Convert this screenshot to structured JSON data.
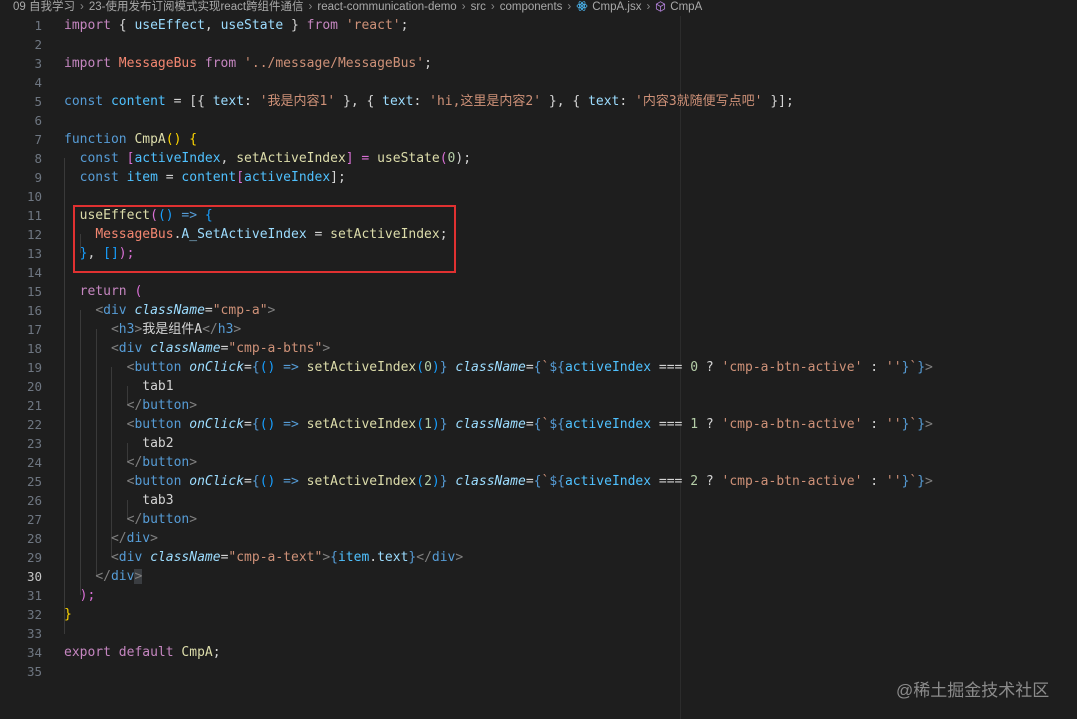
{
  "breadcrumb": {
    "items": [
      "09 自我学习",
      "23-使用发布订阅模式实现react跨组件通信",
      "react-communication-demo",
      "src",
      "components",
      "CmpA.jsx",
      "CmpA"
    ]
  },
  "editor": {
    "active_line": 30,
    "lines": [
      {
        "n": "1"
      },
      {
        "n": "2"
      },
      {
        "n": "3"
      },
      {
        "n": "4"
      },
      {
        "n": "5"
      },
      {
        "n": "6"
      },
      {
        "n": "7"
      },
      {
        "n": "8"
      },
      {
        "n": "9"
      },
      {
        "n": "10"
      },
      {
        "n": "11"
      },
      {
        "n": "12"
      },
      {
        "n": "13"
      },
      {
        "n": "14"
      },
      {
        "n": "15"
      },
      {
        "n": "16"
      },
      {
        "n": "17"
      },
      {
        "n": "18"
      },
      {
        "n": "19"
      },
      {
        "n": "20"
      },
      {
        "n": "21"
      },
      {
        "n": "22"
      },
      {
        "n": "23"
      },
      {
        "n": "24"
      },
      {
        "n": "25"
      },
      {
        "n": "26"
      },
      {
        "n": "27"
      },
      {
        "n": "28"
      },
      {
        "n": "29"
      },
      {
        "n": "30"
      },
      {
        "n": "31"
      },
      {
        "n": "32"
      },
      {
        "n": "33"
      },
      {
        "n": "34"
      },
      {
        "n": "35"
      }
    ]
  },
  "code": {
    "l1": [
      "import",
      " { ",
      "useEffect",
      ", ",
      "useState",
      " } ",
      "from",
      " ",
      "'react'",
      ";"
    ],
    "l3": [
      "import",
      " ",
      "MessageBus",
      " ",
      "from",
      " ",
      "'../message/MessageBus'",
      ";"
    ],
    "l5": [
      "const",
      " ",
      "content",
      " = [{ ",
      "text",
      ": ",
      "'我是内容1'",
      " }, { ",
      "text",
      ": ",
      "'hi,这里是内容2'",
      " }, { ",
      "text",
      ": ",
      "'内容3就随便写点吧'",
      " }];"
    ],
    "l7": [
      "function",
      " ",
      "CmpA",
      "() {"
    ],
    "l8": [
      "const",
      " [",
      "activeIndex",
      ", ",
      "setActiveIndex",
      "] = ",
      "useState",
      "(",
      "0",
      ");"
    ],
    "l9": [
      "const",
      " ",
      "item",
      " = ",
      "content",
      "[",
      "activeIndex",
      "];"
    ],
    "l11": [
      "useEffect",
      "(",
      "()",
      " => ",
      "{"
    ],
    "l12": [
      "MessageBus",
      ".",
      "A_SetActiveIndex",
      " = ",
      "setActiveIndex",
      ";"
    ],
    "l13": [
      "}",
      ", ",
      "[]",
      ");"
    ],
    "l15": [
      "return",
      " ("
    ],
    "l16": [
      "<",
      "div",
      " ",
      "className",
      "=",
      "\"cmp-a\"",
      ">"
    ],
    "l17": [
      "<",
      "h3",
      ">",
      "我是组件A",
      "</",
      "h3",
      ">"
    ],
    "l18": [
      "<",
      "div",
      " ",
      "className",
      "=",
      "\"cmp-a-btns\"",
      ">"
    ],
    "l19": [
      "<",
      "button",
      " ",
      "onClick",
      "=",
      "{",
      "()",
      " => ",
      "setActiveIndex",
      "(",
      "0",
      ")",
      "}",
      " ",
      "className",
      "=",
      "{",
      "`",
      "${",
      "activeIndex",
      " === ",
      "0",
      " ? ",
      "'cmp-a-btn-active'",
      " : ",
      "''",
      "}",
      "`",
      "}",
      ">"
    ],
    "l20": [
      "tab1"
    ],
    "l21": [
      "</",
      "button",
      ">"
    ],
    "l22": [
      "<",
      "button",
      " ",
      "onClick",
      "=",
      "{",
      "()",
      " => ",
      "setActiveIndex",
      "(",
      "1",
      ")",
      "}",
      " ",
      "className",
      "=",
      "{",
      "`",
      "${",
      "activeIndex",
      " === ",
      "1",
      " ? ",
      "'cmp-a-btn-active'",
      " : ",
      "''",
      "}",
      "`",
      "}",
      ">"
    ],
    "l23": [
      "tab2"
    ],
    "l24": [
      "</",
      "button",
      ">"
    ],
    "l25": [
      "<",
      "button",
      " ",
      "onClick",
      "=",
      "{",
      "()",
      " => ",
      "setActiveIndex",
      "(",
      "2",
      ")",
      "}",
      " ",
      "className",
      "=",
      "{",
      "`",
      "${",
      "activeIndex",
      " === ",
      "2",
      " ? ",
      "'cmp-a-btn-active'",
      " : ",
      "''",
      "}",
      "`",
      "}",
      ">"
    ],
    "l26": [
      "tab3"
    ],
    "l27": [
      "</",
      "button",
      ">"
    ],
    "l28": [
      "</",
      "div",
      ">"
    ],
    "l29": [
      "<",
      "div",
      " ",
      "className",
      "=",
      "\"cmp-a-text\"",
      ">",
      "{",
      "item",
      ".",
      "text",
      "}",
      "</",
      "div",
      ">"
    ],
    "l30": [
      "</",
      "div",
      ">"
    ],
    "l31": [
      ");"
    ],
    "l32": [
      "}"
    ],
    "l34": [
      "export",
      " ",
      "default",
      " ",
      "CmpA",
      ";"
    ]
  },
  "watermark": "@稀土掘金技术社区",
  "colors": {
    "background": "#1e1e1e",
    "keyword": "#c586c0",
    "string": "#ce9178",
    "function": "#dcdcaa",
    "variable": "#9cdcfe",
    "highlight_box": "#e03131"
  }
}
